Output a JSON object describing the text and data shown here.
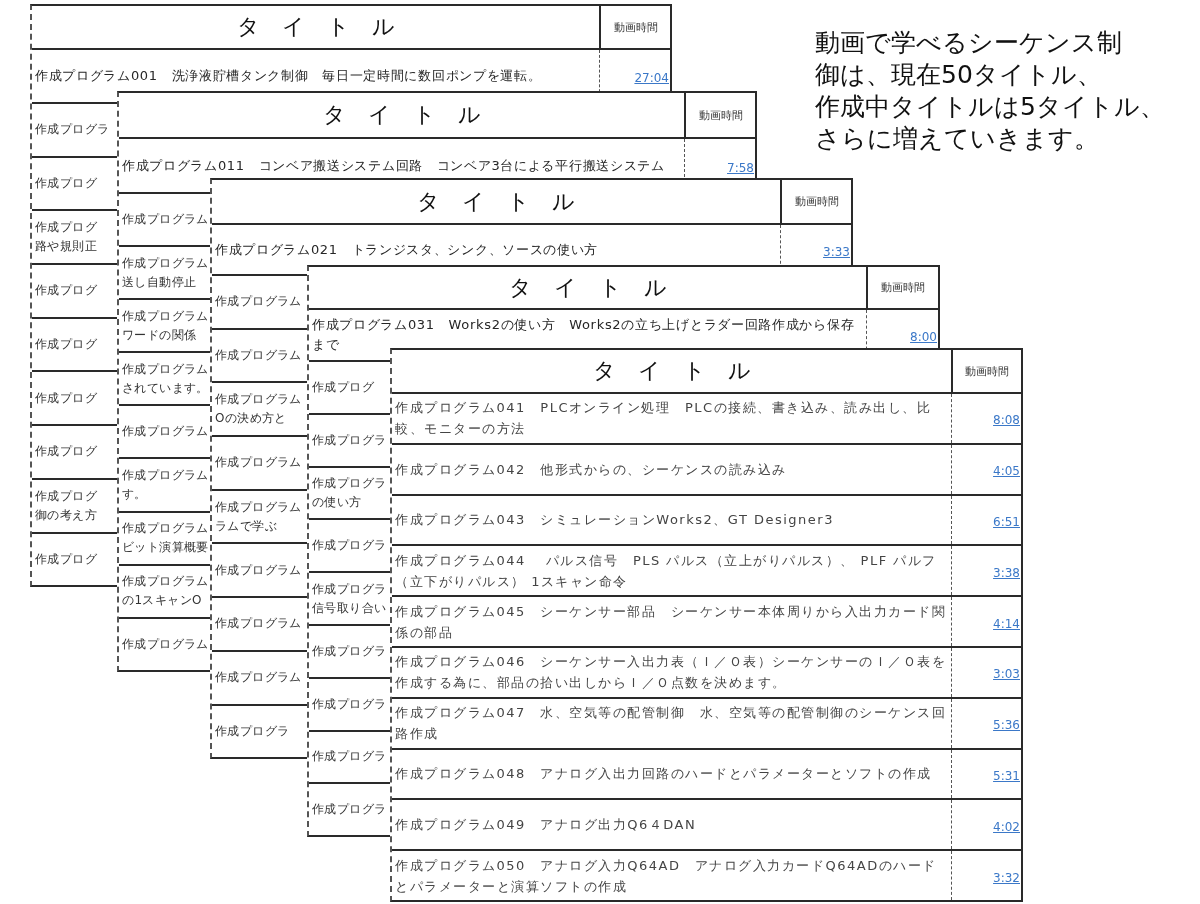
{
  "sheets": [
    {
      "header": {
        "title": "タ　イ　ト　ル",
        "duration": "動画時間"
      },
      "rows": [
        {
          "kind": "full",
          "title": "作成プログラム001　洗浄液貯槽タンク制御　毎日一定時間に数回ポンプを運転。",
          "duration": "27:04"
        },
        {
          "kind": "clipped",
          "lines": [
            "作成プログラ"
          ]
        },
        {
          "kind": "clipped",
          "lines": [
            "作成プログ"
          ]
        },
        {
          "kind": "clipped",
          "lines": [
            "作成プログ",
            "路や規則正"
          ]
        },
        {
          "kind": "clipped",
          "lines": [
            "作成プログ"
          ]
        },
        {
          "kind": "clipped",
          "lines": [
            "作成プログ"
          ]
        },
        {
          "kind": "clipped",
          "lines": [
            "作成プログ"
          ]
        },
        {
          "kind": "clipped",
          "lines": [
            "作成プログ"
          ]
        },
        {
          "kind": "clipped",
          "lines": [
            "作成プログ",
            "御の考え方"
          ]
        },
        {
          "kind": "clipped",
          "lines": [
            "作成プログ"
          ]
        }
      ]
    },
    {
      "header": {
        "title": "タ　イ　ト　ル",
        "duration": "動画時間"
      },
      "rows": [
        {
          "kind": "full",
          "title": "作成プログラム011　コンベア搬送システム回路　コンベア3台による平行搬送システム",
          "duration": "7:58"
        },
        {
          "kind": "clipped",
          "lines": [
            "作成プログラム"
          ]
        },
        {
          "kind": "clipped",
          "lines": [
            "作成プログラム",
            "送し自動停止"
          ]
        },
        {
          "kind": "clipped",
          "lines": [
            "作成プログラム",
            "ワードの関係"
          ]
        },
        {
          "kind": "clipped",
          "lines": [
            "作成プログラム",
            "されています。"
          ]
        },
        {
          "kind": "clipped",
          "lines": [
            "作成プログラム"
          ]
        },
        {
          "kind": "clipped",
          "lines": [
            "作成プログラム",
            "す。"
          ]
        },
        {
          "kind": "clipped",
          "lines": [
            "作成プログラム",
            "ビット演算概要"
          ]
        },
        {
          "kind": "clipped",
          "lines": [
            "作成プログラム",
            "の1スキャンO"
          ]
        },
        {
          "kind": "clipped",
          "lines": [
            "作成プログラム"
          ]
        }
      ]
    },
    {
      "header": {
        "title": "タ　イ　ト　ル",
        "duration": "動画時間"
      },
      "rows": [
        {
          "kind": "full",
          "title": "作成プログラム021　トランジスタ、シンク、ソースの使い方",
          "duration": "3:33"
        },
        {
          "kind": "clipped",
          "lines": [
            "作成プログラム"
          ]
        },
        {
          "kind": "clipped",
          "lines": [
            "作成プログラム"
          ]
        },
        {
          "kind": "clipped",
          "lines": [
            "作成プログラム",
            "Oの決め方と"
          ]
        },
        {
          "kind": "clipped",
          "lines": [
            "作成プログラム"
          ]
        },
        {
          "kind": "clipped",
          "lines": [
            "作成プログラム",
            "ラムで学ぶ"
          ]
        },
        {
          "kind": "clipped",
          "lines": [
            "作成プログラム"
          ]
        },
        {
          "kind": "clipped",
          "lines": [
            "作成プログラム"
          ]
        },
        {
          "kind": "clipped",
          "lines": [
            "作成プログラム"
          ]
        },
        {
          "kind": "clipped",
          "lines": [
            "作成プログラ"
          ]
        }
      ]
    },
    {
      "header": {
        "title": "タ　イ　ト　ル",
        "duration": "動画時間"
      },
      "rows": [
        {
          "kind": "full",
          "title": "作成プログラム031　Works2の使い方　Works2の立ち上げとラダー回路作成から保存まで",
          "duration": "8:00"
        },
        {
          "kind": "clipped",
          "lines": [
            "作成プログ"
          ]
        },
        {
          "kind": "clipped",
          "lines": [
            "作成プログラ"
          ]
        },
        {
          "kind": "clipped",
          "lines": [
            "作成プログラ",
            "の使い方"
          ]
        },
        {
          "kind": "clipped",
          "lines": [
            "作成プログラ"
          ]
        },
        {
          "kind": "clipped",
          "lines": [
            "作成プログラ",
            "信号取り合い"
          ]
        },
        {
          "kind": "clipped",
          "lines": [
            "作成プログラ"
          ]
        },
        {
          "kind": "clipped",
          "lines": [
            "作成プログラ"
          ]
        },
        {
          "kind": "clipped",
          "lines": [
            "作成プログラ"
          ]
        },
        {
          "kind": "clipped",
          "lines": [
            "作成プログラ"
          ]
        }
      ]
    },
    {
      "header": {
        "title": "タ　イ　ト　ル",
        "duration": "動画時間"
      },
      "rows": [
        {
          "kind": "full",
          "title": "作成プログラム041　PLCオンライン処理　PLCの接続、書き込み、読み出し、比較、モニターの方法",
          "duration": "8:08"
        },
        {
          "kind": "full",
          "title": "作成プログラム042　他形式からの、シーケンスの読み込み",
          "duration": "4:05"
        },
        {
          "kind": "full",
          "title": "作成プログラム043　シミュレーションWorks2、GT Designer3",
          "duration": "6:51"
        },
        {
          "kind": "full",
          "title": "作成プログラム044　 パルス信号　PLS パルス（立上がりパルス）、 PLF パルフ（立下がりパルス） 1スキャン命令",
          "duration": "3:38"
        },
        {
          "kind": "full",
          "title": "作成プログラム045　シーケンサー部品　シーケンサー本体周りから入出力カード関係の部品",
          "duration": "4:14"
        },
        {
          "kind": "full",
          "title": "作成プログラム046　シーケンサー入出力表（Ｉ／Ｏ表）シーケンサーのＩ／Ｏ表を作成する為に、部品の拾い出しからＩ／Ｏ点数を決めます。",
          "duration": "3:03"
        },
        {
          "kind": "full",
          "title": "作成プログラム047　水、空気等の配管制御　水、空気等の配管制御のシーケンス回路作成",
          "duration": "5:36"
        },
        {
          "kind": "full",
          "title": "作成プログラム048　アナログ入出力回路のハードとパラメーターとソフトの作成",
          "duration": "5:31"
        },
        {
          "kind": "full",
          "title": "作成プログラム049　アナログ出力Q6４DAN",
          "duration": "4:02"
        },
        {
          "kind": "full",
          "title": "作成プログラム050　アナログ入力Q64AD　アナログ入力カードQ64ADのハードとパラメーターと演算ソフトの作成",
          "duration": "3:32"
        }
      ]
    }
  ],
  "notice": {
    "lines": [
      "動画で学べるシーケンス制",
      "御は、現在50タイトル、",
      "作成中タイトルは5タイトル、",
      "さらに増えていきます。"
    ]
  }
}
